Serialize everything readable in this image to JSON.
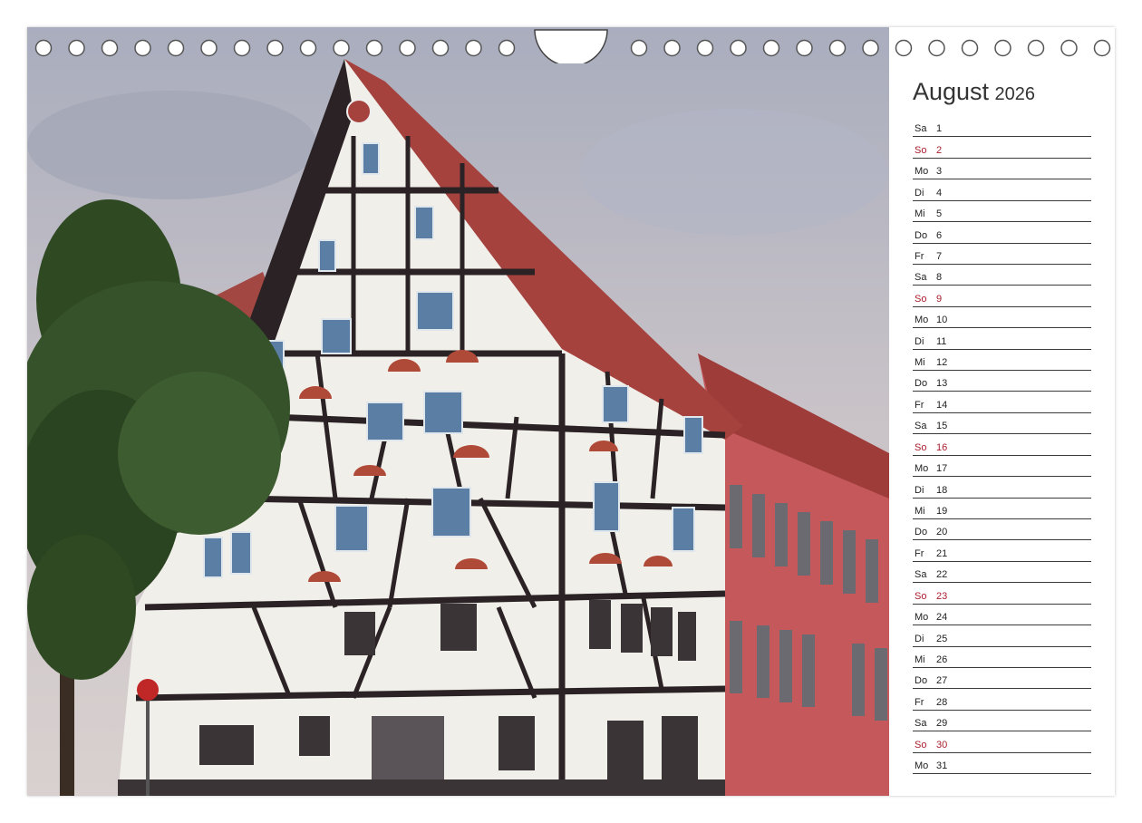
{
  "calendar": {
    "month": "August",
    "year": "2026",
    "sunday_color": "#a8202d",
    "days": [
      {
        "wd": "Sa",
        "d": "1"
      },
      {
        "wd": "So",
        "d": "2"
      },
      {
        "wd": "Mo",
        "d": "3"
      },
      {
        "wd": "Di",
        "d": "4"
      },
      {
        "wd": "Mi",
        "d": "5"
      },
      {
        "wd": "Do",
        "d": "6"
      },
      {
        "wd": "Fr",
        "d": "7"
      },
      {
        "wd": "Sa",
        "d": "8"
      },
      {
        "wd": "So",
        "d": "9"
      },
      {
        "wd": "Mo",
        "d": "10"
      },
      {
        "wd": "Di",
        "d": "11"
      },
      {
        "wd": "Mi",
        "d": "12"
      },
      {
        "wd": "Do",
        "d": "13"
      },
      {
        "wd": "Fr",
        "d": "14"
      },
      {
        "wd": "Sa",
        "d": "15"
      },
      {
        "wd": "So",
        "d": "16"
      },
      {
        "wd": "Mo",
        "d": "17"
      },
      {
        "wd": "Di",
        "d": "18"
      },
      {
        "wd": "Mi",
        "d": "19"
      },
      {
        "wd": "Do",
        "d": "20"
      },
      {
        "wd": "Fr",
        "d": "21"
      },
      {
        "wd": "Sa",
        "d": "22"
      },
      {
        "wd": "So",
        "d": "23"
      },
      {
        "wd": "Mo",
        "d": "24"
      },
      {
        "wd": "Di",
        "d": "25"
      },
      {
        "wd": "Mi",
        "d": "26"
      },
      {
        "wd": "Do",
        "d": "27"
      },
      {
        "wd": "Fr",
        "d": "28"
      },
      {
        "wd": "Sa",
        "d": "29"
      },
      {
        "wd": "So",
        "d": "30"
      },
      {
        "wd": "Mo",
        "d": "31"
      }
    ]
  },
  "photo": {
    "subject": "half-timbered-house",
    "sky_color": "#b9bcc8",
    "roof_color": "#a2403c",
    "timber_color": "#2a2224",
    "plaster_color": "#f2f0ec",
    "side_building_color": "#c9585a",
    "tree_color": "#2f4a22"
  }
}
